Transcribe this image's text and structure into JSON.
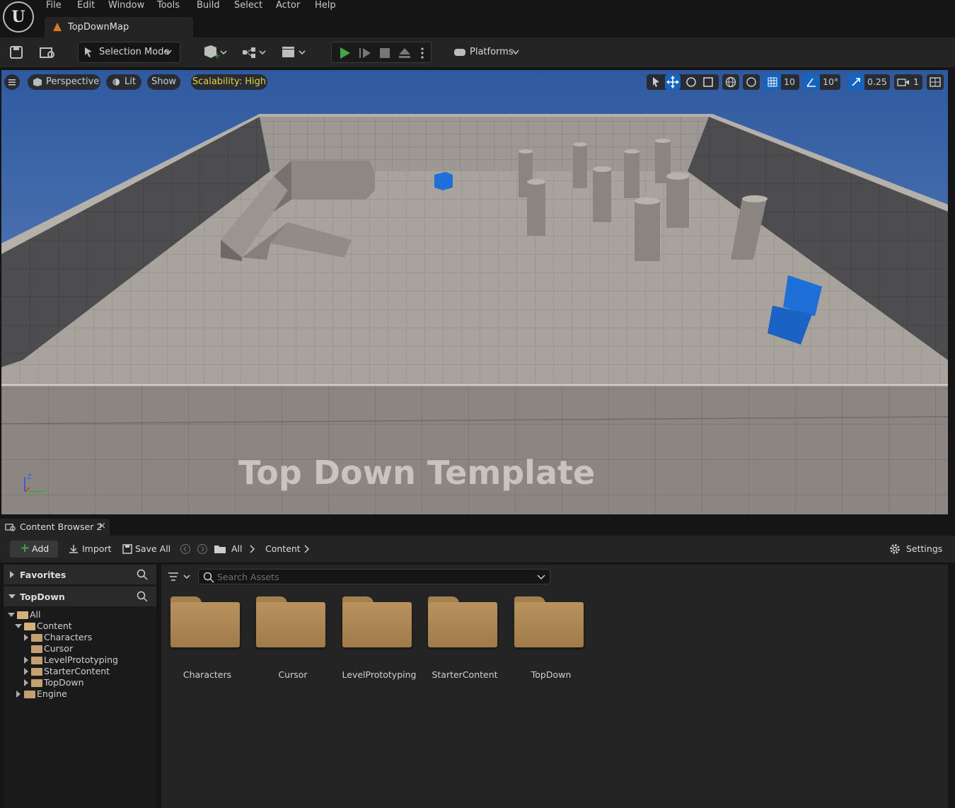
{
  "menu": {
    "items": [
      "File",
      "Edit",
      "Window",
      "Tools",
      "Build",
      "Select",
      "Actor",
      "Help"
    ]
  },
  "document_tab": {
    "title": "TopDownMap"
  },
  "toolbar": {
    "selection_mode": "Selection Mode",
    "platforms": "Platforms"
  },
  "viewport": {
    "perspective": "Perspective",
    "lit": "Lit",
    "show": "Show",
    "scalability": "Scalability: High",
    "grid_snap": "10",
    "rotation_snap": "10°",
    "scale_snap": "0.25",
    "camera_speed": "1",
    "scene_text": "Top Down Template",
    "axis": {
      "z": "Z",
      "y": "Y"
    }
  },
  "content_browser": {
    "tab_title": "Content Browser 2",
    "add": "Add",
    "import": "Import",
    "save_all": "Save All",
    "breadcrumb": [
      "All",
      "Content"
    ],
    "settings": "Settings",
    "favorites": "Favorites",
    "project": "TopDown",
    "search_placeholder": "Search Assets",
    "tree": {
      "all": "All",
      "content": "Content",
      "characters": "Characters",
      "cursor": "Cursor",
      "levelprototyping": "LevelPrototyping",
      "startercontent": "StarterContent",
      "topdown": "TopDown",
      "engine": "Engine"
    },
    "folders": [
      "Characters",
      "Cursor",
      "LevelPrototyping",
      "StarterContent",
      "TopDown"
    ]
  },
  "colors": {
    "accent_blue": "#1565c0",
    "play_green": "#3fa844",
    "scalability_yellow": "#e6d23a",
    "folder": "#b58b58"
  }
}
